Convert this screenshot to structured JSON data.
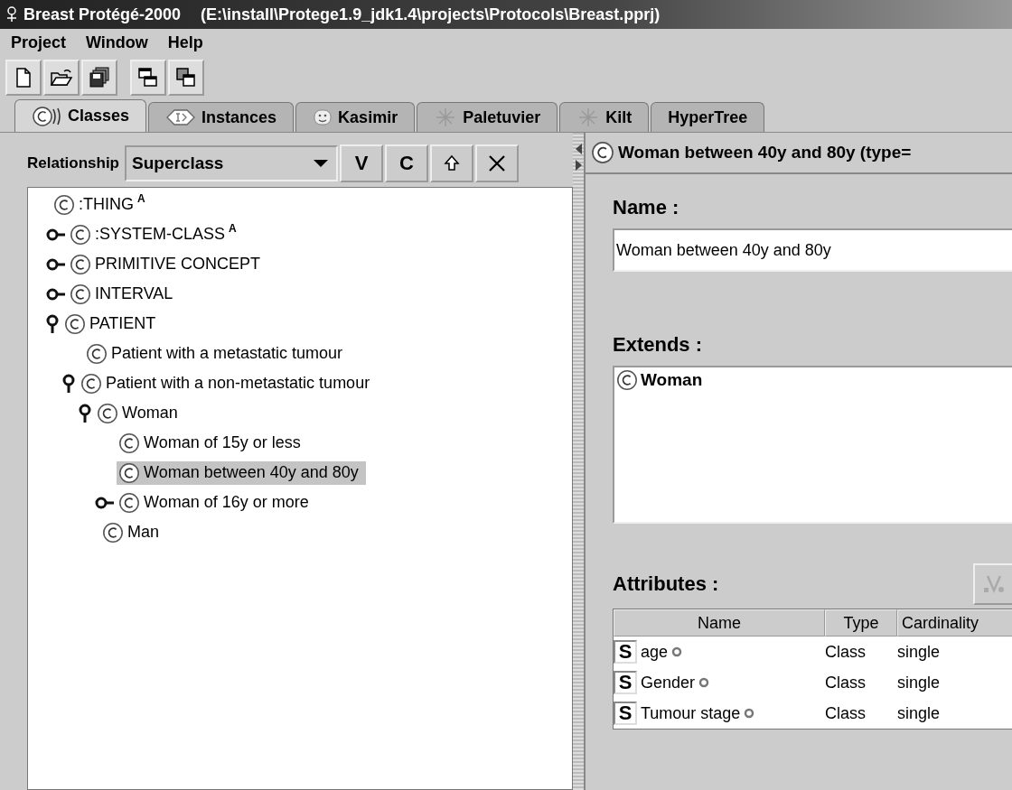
{
  "window": {
    "title": "Breast Protégé-2000",
    "path": "(E:\\install\\Protege1.9_jdk1.4\\projects\\Protocols\\Breast.pprj)"
  },
  "menu": [
    "Project",
    "Window",
    "Help"
  ],
  "toolbar": [
    {
      "kind": "new"
    },
    {
      "kind": "open"
    },
    {
      "kind": "save"
    },
    {
      "kind": "cascade"
    },
    {
      "kind": "tile"
    }
  ],
  "tabs": [
    {
      "label": "Classes",
      "kind": "classes",
      "selected": true
    },
    {
      "label": "Instances",
      "kind": "instances",
      "selected": false
    },
    {
      "label": "Kasimir",
      "kind": "face",
      "selected": false
    },
    {
      "label": "Paletuvier",
      "kind": "sparkle",
      "selected": false
    },
    {
      "label": "Kilt",
      "kind": "sparkle",
      "selected": false
    },
    {
      "label": "HyperTree",
      "kind": "none",
      "selected": false
    }
  ],
  "relationship": {
    "label": "Relationship",
    "value": "Superclass",
    "buttons": [
      {
        "kind": "text",
        "label": "V"
      },
      {
        "kind": "text",
        "label": "C"
      },
      {
        "kind": "up"
      },
      {
        "kind": "delete"
      }
    ]
  },
  "tree": [
    {
      "name": ":THING",
      "badge": "A",
      "selected": false,
      "children": [
        {
          "name": ":SYSTEM-CLASS",
          "badge": "A",
          "expanded": false,
          "selected": false
        },
        {
          "name": "PRIMITIVE CONCEPT",
          "expanded": false,
          "selected": false
        },
        {
          "name": "INTERVAL",
          "expanded": false,
          "selected": false
        },
        {
          "name": "PATIENT",
          "expanded": true,
          "selected": false,
          "children": [
            {
              "name": "Patient with a metastatic tumour",
              "selected": false
            },
            {
              "name": "Patient with a non-metastatic tumour",
              "expanded": true,
              "selected": false,
              "children": [
                {
                  "name": "Woman",
                  "expanded": true,
                  "selected": false,
                  "children": [
                    {
                      "name": "Woman of 15y or less",
                      "selected": false
                    },
                    {
                      "name": "Woman between 40y and 80y",
                      "selected": true
                    },
                    {
                      "name": "Woman of 16y or more",
                      "expanded": false,
                      "selected": false
                    }
                  ]
                },
                {
                  "name": "Man",
                  "selected": false
                }
              ]
            }
          ]
        }
      ]
    }
  ],
  "detail": {
    "header": "Woman between 40y and 80y (type=",
    "name_label": "Name :",
    "name_value": "Woman between 40y and 80y",
    "extends_label": "Extends :",
    "extends": [
      "Woman"
    ],
    "attributes_label": "Attributes :",
    "columns": [
      "Name",
      "Type",
      "Cardinality"
    ],
    "attributes": [
      {
        "facet": "S",
        "name": "age",
        "type": "Class",
        "cardinality": "single"
      },
      {
        "facet": "S",
        "name": "Gender",
        "type": "Class",
        "cardinality": "single"
      },
      {
        "facet": "S",
        "name": "Tumour stage",
        "type": "Class",
        "cardinality": "single"
      }
    ]
  }
}
